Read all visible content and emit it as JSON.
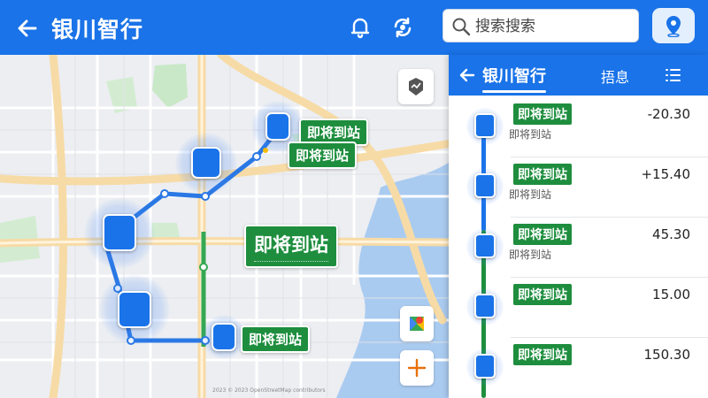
{
  "colors": {
    "primary": "#1a73e8",
    "status_green": "#1e8e3e",
    "map_road_yellow": "#f7dba6",
    "map_water": "#aacbf0",
    "map_park": "#c9e8c7"
  },
  "header": {
    "back_icon": "arrow-left-icon",
    "title": "银川智行",
    "bell_icon": "bell-icon",
    "sync_icon": "sync-icon",
    "search": {
      "placeholder": "搜索搜索",
      "icon": "search-icon"
    },
    "location_icon": "location-pin-icon"
  },
  "map": {
    "labels": [
      {
        "text": "即将到站"
      },
      {
        "text": "即将到站"
      },
      {
        "text": "即将到站"
      },
      {
        "text": "即将到站"
      }
    ],
    "controls": {
      "layers_icon": "layers-icon",
      "maps_icon": "google-maps-icon",
      "zoom_icon": "plus-icon"
    },
    "copyright": "2023 © 2023 OpenStreetMap contributors"
  },
  "panel": {
    "back_icon": "arrow-left-icon",
    "title": "银川智行",
    "tab": "捂息",
    "menu_icon": "list-icon",
    "rows": [
      {
        "status": "即将到站",
        "sub": "即将到站",
        "time": "-20.30"
      },
      {
        "status": "即将到站",
        "sub": "即将到站",
        "time": "+15.40"
      },
      {
        "status": "即将到站",
        "sub": "即将到站",
        "time": "45.30"
      },
      {
        "status": "即将到站",
        "sub": "",
        "time": "15.00"
      },
      {
        "status": "即将到站",
        "sub": "",
        "time": "150.30"
      }
    ]
  }
}
